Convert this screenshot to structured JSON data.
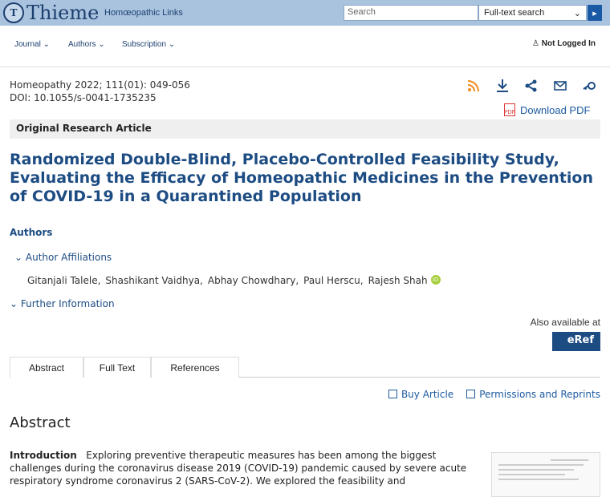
{
  "header": {
    "logo": "Thieme",
    "tagline": "Homœopathic Links",
    "search_placeholder": "Search",
    "search_mode": "Full-text search"
  },
  "nav": {
    "items": [
      "Journal",
      "Authors",
      "Subscription"
    ],
    "login": "Not Logged In"
  },
  "article": {
    "citation": "Homeopathy 2022; 111(01): 049-056",
    "doi": "DOI: 10.1055/s-0041-1735235",
    "download_pdf": "Download PDF",
    "type": "Original Research Article",
    "title": "Randomized Double-Blind, Placebo-Controlled Feasibility Study, Evaluating the Efficacy of Homeopathic Medicines in the Prevention of COVID-19 in a Quarantined Population",
    "authors_heading": "Authors",
    "affiliations_label": "Author Affiliations",
    "authors": [
      "Gitanjali Talele,",
      "Shashikant Vaidhya,",
      "Abhay Chowdhary,",
      "Paul Herscu,",
      "Rajesh Shah"
    ],
    "further_info": "Further Information",
    "also_available": "Also available at",
    "eref": "eRef"
  },
  "tabs": [
    "Abstract",
    "Full Text",
    "References"
  ],
  "actions": {
    "buy": "Buy Article",
    "permissions": "Permissions and Reprints"
  },
  "abstract": {
    "heading": "Abstract",
    "intro_label": "Introduction",
    "intro_text": "Exploring preventive therapeutic measures has been among the biggest challenges during the coronavirus disease 2019 (COVID-19) pandemic caused by severe acute respiratory syndrome coronavirus 2 (SARS-CoV-2). We explored the feasibility and"
  },
  "colors": {
    "accent": "#1d4c83",
    "topbar": "#a9c3df",
    "rss": "#f28a1c"
  }
}
